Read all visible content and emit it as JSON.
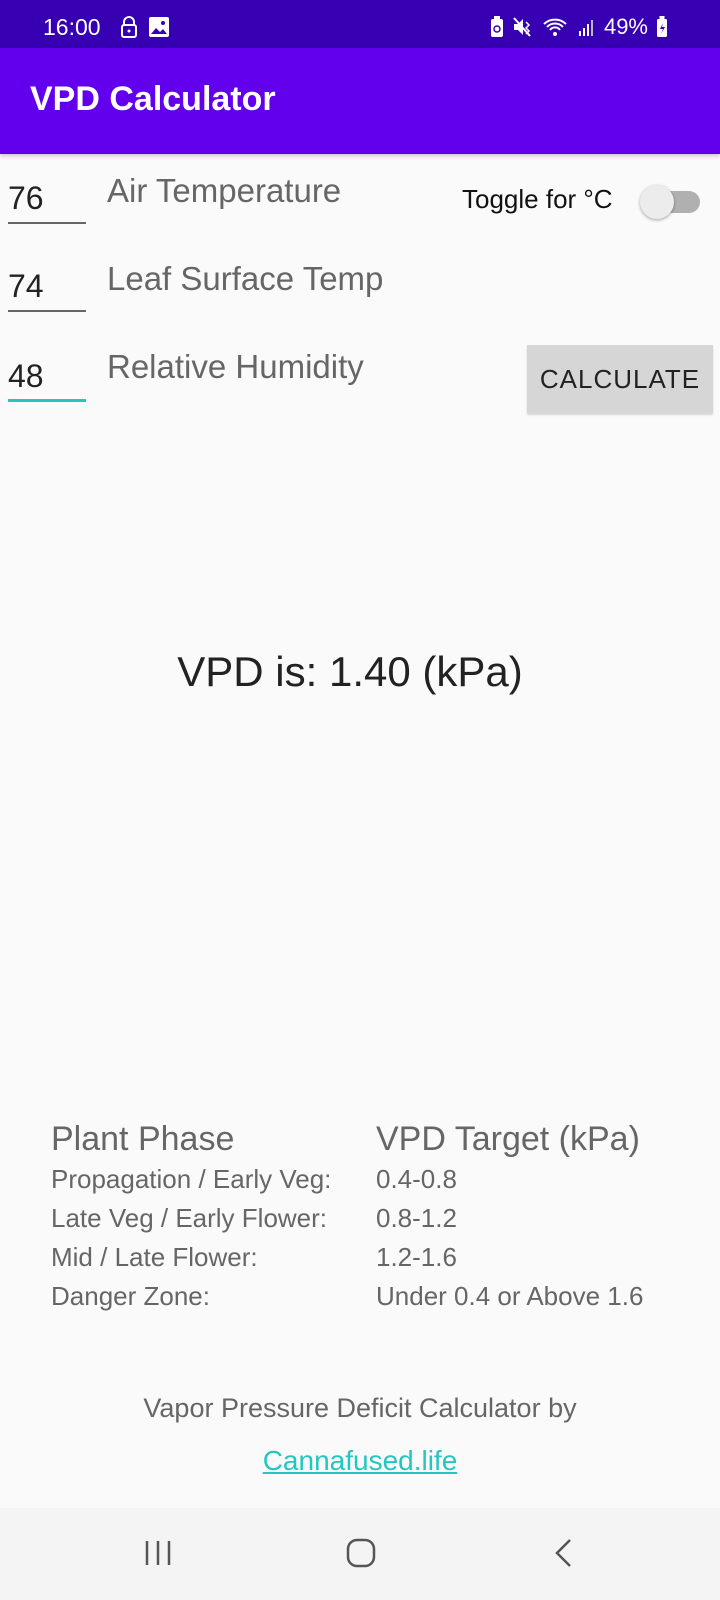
{
  "status_bar": {
    "time": "16:00",
    "left_icons": [
      "lock-icon",
      "image-icon"
    ],
    "right_icons": [
      "battery-saver-icon",
      "mute-icon",
      "wifi-icon",
      "signal-icon"
    ],
    "battery": "49%"
  },
  "app_bar": {
    "title": "VPD Calculator"
  },
  "inputs": [
    {
      "value": "76",
      "label": "Air Temperature"
    },
    {
      "value": "74",
      "label": "Leaf Surface Temp"
    },
    {
      "value": "48",
      "label": "Relative Humidity"
    }
  ],
  "toggle": {
    "label": "Toggle for °C",
    "checked": false
  },
  "calculate_button": {
    "label": "CALCULATE"
  },
  "result": {
    "text": "VPD is: 1.40 (kPa)"
  },
  "table": {
    "headers": [
      "Plant Phase",
      "VPD Target (kPa)"
    ],
    "rows": [
      [
        "Propagation / Early Veg:",
        "0.4-0.8"
      ],
      [
        "Late Veg / Early Flower:",
        "0.8-1.2"
      ],
      [
        "Mid / Late Flower:",
        "1.2-1.6"
      ],
      [
        "Danger Zone:",
        "Under 0.4 or Above 1.6"
      ]
    ]
  },
  "footer": {
    "text": "Vapor Pressure Deficit Calculator by",
    "link": "Cannafused.life"
  },
  "nav": [
    "recents-icon",
    "home-icon",
    "back-icon"
  ],
  "colors": {
    "primary": "#6200ee",
    "primary_dark": "#3700b3",
    "accent": "#26c6c0"
  }
}
